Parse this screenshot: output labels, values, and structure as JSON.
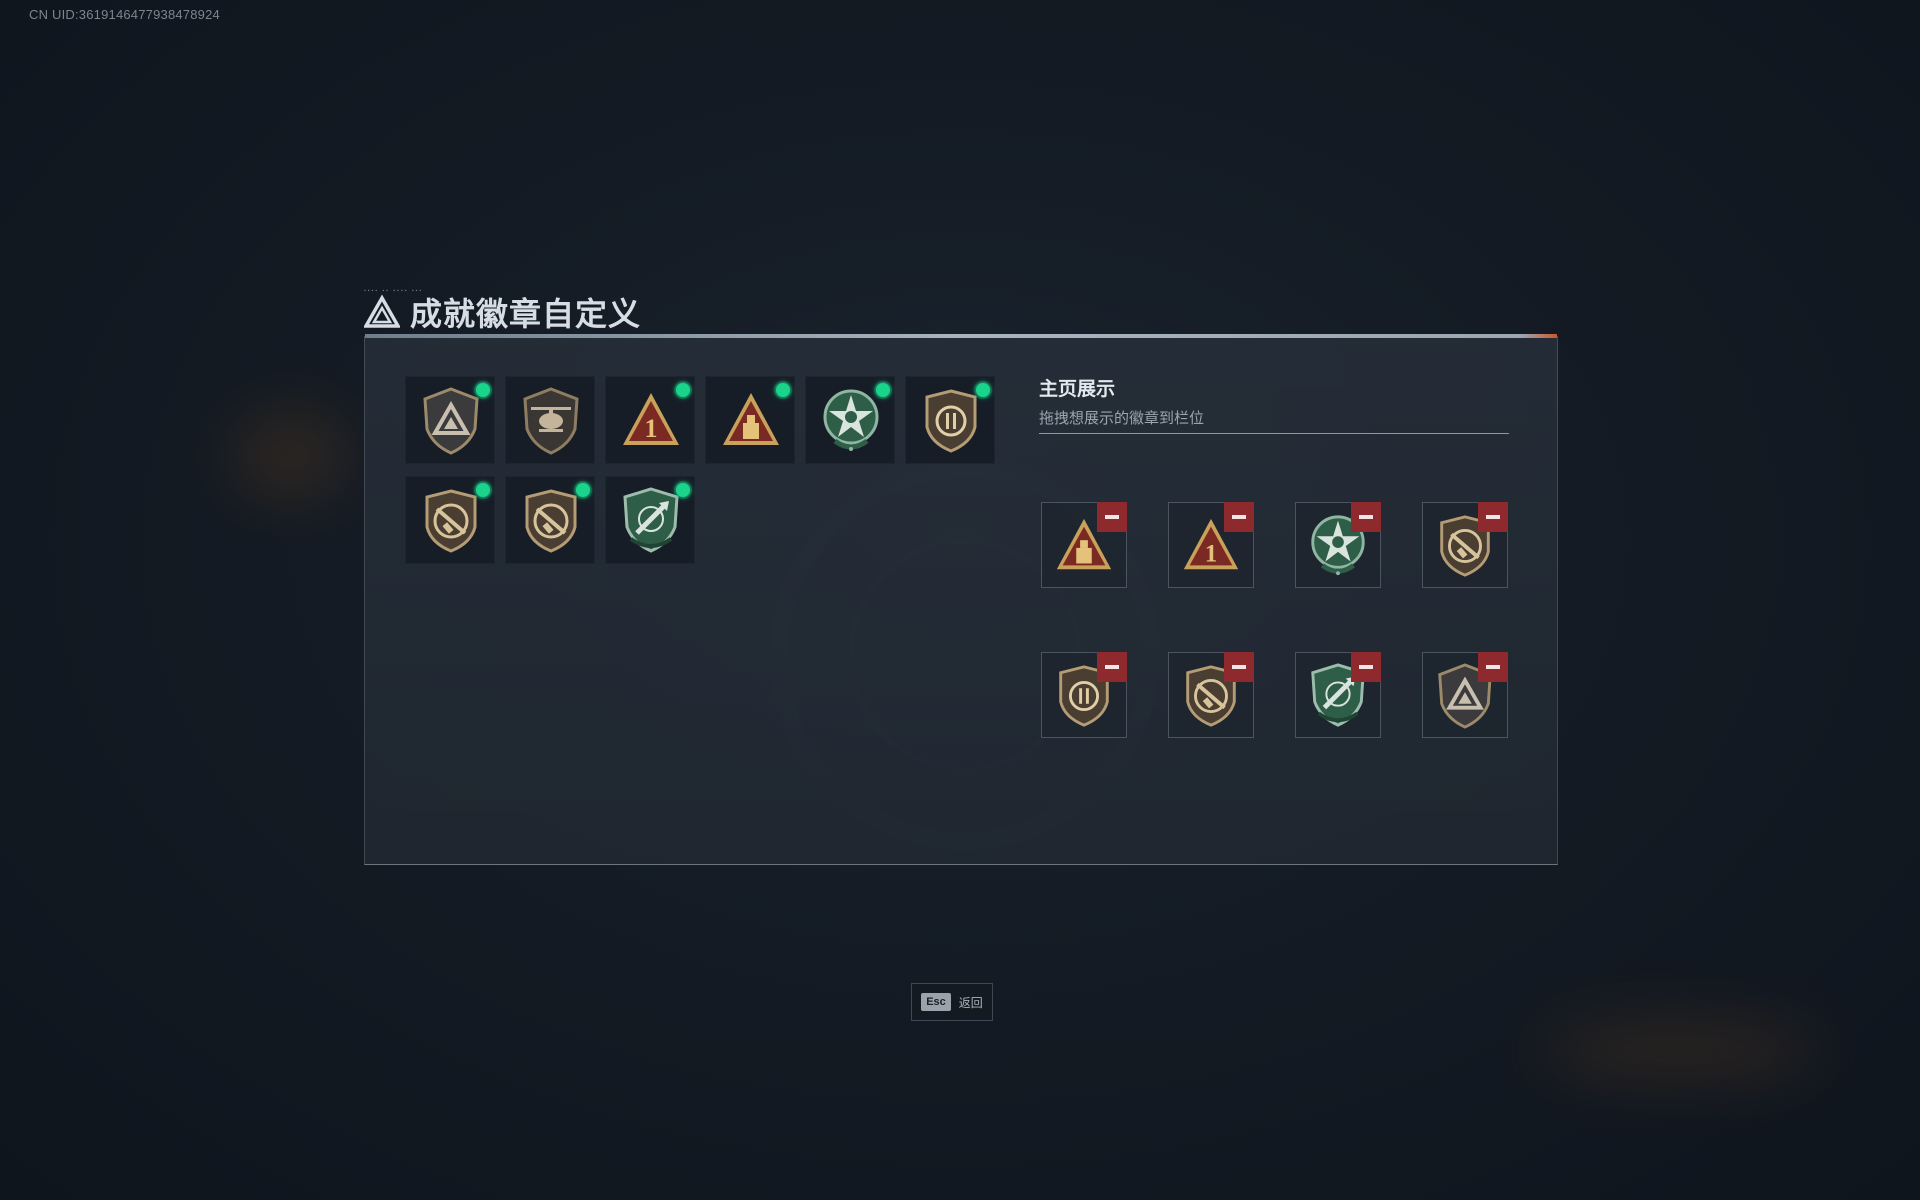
{
  "uid_text": "CN UID:3619146477938478924",
  "title": "成就徽章自定义",
  "colors": {
    "accent_green": "#19d48a",
    "remove_red": "#8e2a2e",
    "gold": "#c9a15a",
    "shield_green": "#2f5e48"
  },
  "owned_badges": [
    {
      "icon": "triangle-shield-badge-icon",
      "has_new": true
    },
    {
      "icon": "helicopter-shield-badge-icon",
      "has_new": false
    },
    {
      "icon": "gold-triangle-number-one-badge-icon",
      "has_new": true
    },
    {
      "icon": "gold-triangle-tower-badge-icon",
      "has_new": true
    },
    {
      "icon": "green-star-skull-badge-icon",
      "has_new": true
    },
    {
      "icon": "pause-shield-badge-icon",
      "has_new": true
    },
    {
      "icon": "rifle-shield-badge-icon",
      "has_new": true
    },
    {
      "icon": "rifle-shield-badge-icon",
      "has_new": true
    },
    {
      "icon": "green-rocket-shield-badge-icon",
      "has_new": true
    }
  ],
  "showcase": {
    "title": "主页展示",
    "subtitle": "拖拽想展示的徽章到栏位",
    "slots": [
      {
        "icon": "gold-triangle-tower-badge-icon"
      },
      {
        "icon": "gold-triangle-number-one-badge-icon"
      },
      {
        "icon": "green-star-skull-badge-icon"
      },
      {
        "icon": "rifle-shield-badge-icon"
      },
      {
        "icon": "pause-shield-badge-icon"
      },
      {
        "icon": "rifle-shield-badge-icon"
      },
      {
        "icon": "green-rocket-shield-badge-icon"
      },
      {
        "icon": "triangle-shield-badge-icon"
      }
    ]
  },
  "footer": {
    "key": "Esc",
    "label": "返回"
  }
}
